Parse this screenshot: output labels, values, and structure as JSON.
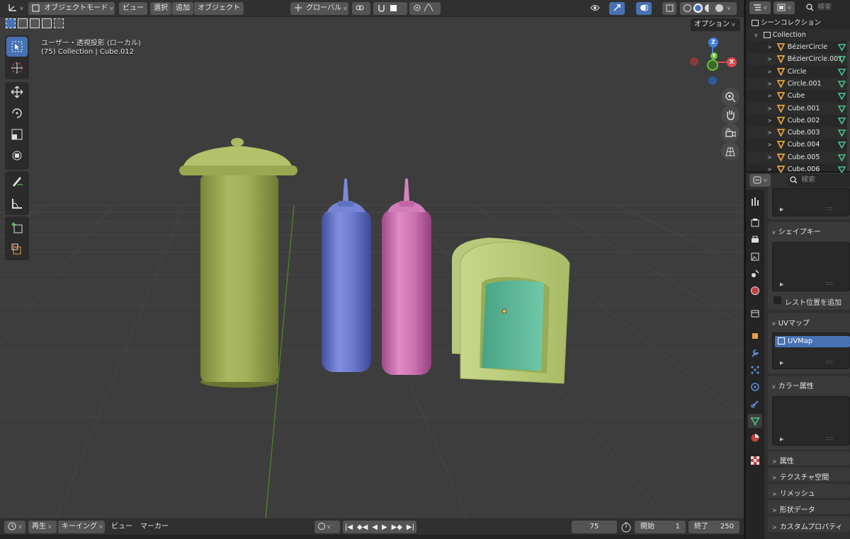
{
  "viewport_header": {
    "mode_label": "オブジェクトモード",
    "menu_view": "ビュー",
    "menu_select": "選択",
    "menu_add": "追加",
    "menu_object": "オブジェクト",
    "transform_orientation": "グローバル",
    "options_label": "オプション"
  },
  "viewport_info": {
    "view_name": "ユーザー・透視投影 (ローカル)",
    "collection_path": "(75) Collection | Cube.012"
  },
  "gizmo": {
    "x": "X",
    "y": "Y",
    "z": "Z"
  },
  "outliner": {
    "search_placeholder": "検索",
    "scene_collection": "シーンコレクション",
    "collection": "Collection",
    "objects": [
      "BézierCircle",
      "BézierCircle.001",
      "Circle",
      "Circle.001",
      "Cube",
      "Cube.001",
      "Cube.002",
      "Cube.003",
      "Cube.004",
      "Cube.005",
      "Cube.006"
    ]
  },
  "properties": {
    "search_placeholder": "検索",
    "shape_keys": "シェイプキー",
    "add_rest_position": "レスト位置を追加",
    "uv_maps": "UVマップ",
    "uv_map_item": "UVMap",
    "color_attributes": "カラー属性",
    "attributes": "属性",
    "texture_space": "テクスチャ空間",
    "remesh": "リメッシュ",
    "shape_data": "形状データ",
    "custom_properties": "カスタムプロパティ"
  },
  "timeline": {
    "playback": "再生",
    "keying": "キーイング",
    "view": "ビュー",
    "marker": "マーカー",
    "current_frame": "75",
    "start_label": "開始",
    "start_value": "1",
    "end_label": "終了",
    "end_value": "250"
  },
  "colors": {
    "accent": "#4772b3",
    "jar": "#a4b05a",
    "bottle_blue": "#6a78c8",
    "bottle_pink": "#c86aa8",
    "frame_green": "#b9cc78",
    "screen_teal": "#5fb89a"
  }
}
